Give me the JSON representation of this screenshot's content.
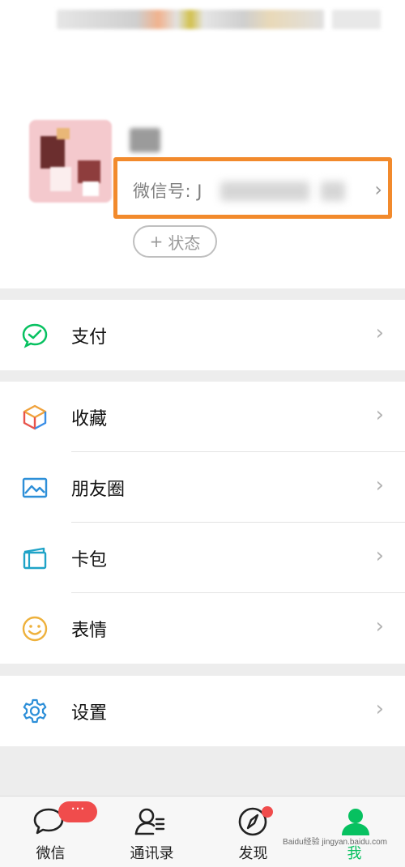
{
  "profile": {
    "wechat_id_prefix": "微信号: J",
    "status_button": {
      "plus": "+",
      "label": "状态"
    }
  },
  "menu": [
    {
      "label": "支付",
      "icon": "pay-icon"
    },
    {
      "label": "收藏",
      "icon": "favorites-cube-icon"
    },
    {
      "label": "朋友圈",
      "icon": "moments-picture-icon"
    },
    {
      "label": "卡包",
      "icon": "card-wallet-icon"
    },
    {
      "label": "表情",
      "icon": "smile-face-icon"
    },
    {
      "label": "设置",
      "icon": "gear-icon"
    }
  ],
  "tabbar": {
    "tabs": [
      {
        "label": "微信",
        "icon": "chat-bubble-icon",
        "badge": "···"
      },
      {
        "label": "通讯录",
        "icon": "contacts-icon"
      },
      {
        "label": "发现",
        "icon": "compass-icon",
        "dot": true
      },
      {
        "label": "我",
        "icon": "me-person-icon",
        "active": true
      }
    ]
  },
  "colors": {
    "wechat_green": "#07c160",
    "highlight_orange": "#f28a2c",
    "badge_red": "#f04c4c",
    "background_gray": "#ededed"
  },
  "watermark": "Baidu经验 jingyan.baidu.com"
}
